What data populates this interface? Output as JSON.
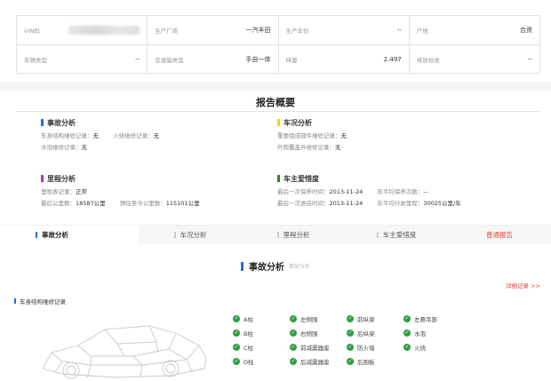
{
  "vehicle_info": {
    "row1": [
      {
        "label": "VIN码",
        "value": ""
      },
      {
        "label": "生产厂商",
        "value": "一汽丰田"
      },
      {
        "label": "生产年份",
        "value": "--"
      },
      {
        "label": "产地",
        "value": "合资"
      }
    ],
    "row2": [
      {
        "label": "车辆类型",
        "value": "--"
      },
      {
        "label": "变速箱类型",
        "value": "手自一体"
      },
      {
        "label": "排量",
        "value": "2.497"
      },
      {
        "label": "排放标准",
        "value": "--"
      }
    ]
  },
  "overview": {
    "title": "报告概要",
    "accident": {
      "title": "事故分析",
      "color": "#2d6bd1",
      "lines": [
        [
          {
            "k": "车身结构维修记录：",
            "v": "无"
          },
          {
            "k": "火烧维修记录：",
            "v": "无"
          }
        ],
        [
          {
            "k": "水泡维修记录：",
            "v": "无"
          }
        ]
      ]
    },
    "condition": {
      "title": "车况分析",
      "color": "#f2d600",
      "lines": [
        [
          {
            "k": "重要组成部件维修记录：",
            "v": "无"
          }
        ],
        [
          {
            "k": "外观覆盖件维修记录：",
            "v": "无"
          }
        ]
      ]
    },
    "mileage": {
      "title": "里程分析",
      "color": "#b12fc9",
      "lines": [
        [
          {
            "k": "里程表记录：",
            "v": "正常"
          }
        ],
        [
          {
            "k": "最后公里数：",
            "v": "18587公里"
          },
          {
            "k": "预估至今公里数：",
            "v": "115101公里"
          }
        ]
      ]
    },
    "care": {
      "title": "车主爱惜度",
      "color": "#3a7d1f",
      "lines": [
        [
          {
            "k": "最后一次保养时间：",
            "v": "2013-11-24"
          },
          {
            "k": "年平均保养次数：",
            "v": "--"
          }
        ],
        [
          {
            "k": "最后一次进店时间：",
            "v": "2013-11-24"
          },
          {
            "k": "年平均行驶里程：",
            "v": "30025公里/年"
          }
        ]
      ]
    }
  },
  "tabs": [
    {
      "label": "事故分析"
    },
    {
      "label": "车况分析"
    },
    {
      "label": "里程分析"
    },
    {
      "label": "车主爱惜度"
    },
    {
      "label": "普通报告"
    }
  ],
  "accident_section": {
    "title": "事故分析",
    "subtitle": "事故分析",
    "detail_link": "详细记录 >>",
    "structure_heading": "车身结构维修记录",
    "checks": [
      "A柱",
      "左侧围",
      "前纵梁",
      "左悬吊部",
      "B柱",
      "右侧围",
      "后纵梁",
      "水泡",
      "C柱",
      "前减震器座",
      "防火墙",
      "火烧",
      "D柱",
      "后减震器座",
      "后围板"
    ]
  }
}
